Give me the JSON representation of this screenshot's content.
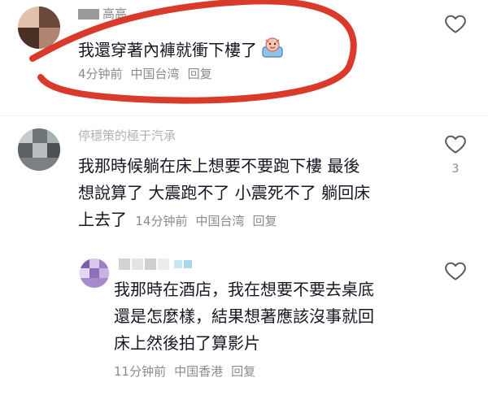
{
  "comments": [
    {
      "username": "高高",
      "text": "我還穿著內褲就衝下樓了",
      "time": "4分钟前",
      "location": "中国台湾",
      "reply": "回复",
      "likes": "",
      "icon": "heart-outline-icon"
    },
    {
      "username": "停穩策的極于汽承",
      "text_lines": [
        "我那時候躺在床上想要不要跑下樓 最後",
        "想說算了 大震跑不了 小震死不了 躺回床",
        "上去了"
      ],
      "time": "14分钟前",
      "location": "中国台湾",
      "reply": "回复",
      "likes": "3",
      "icon": "heart-outline-icon"
    },
    {
      "username": "",
      "text_lines": [
        "我那時在酒店，我在想要不要去桌底",
        "還是怎麼樣，結果想著應該沒事就回",
        "床上然後拍了算影片"
      ],
      "time": "11分钟前",
      "location": "中国香港",
      "reply": "回复",
      "likes": "",
      "icon": "heart-outline-icon"
    }
  ],
  "colors": {
    "text": "#161823",
    "secondary": "#8a8b91",
    "annotation_circle": "#d93a2b"
  }
}
